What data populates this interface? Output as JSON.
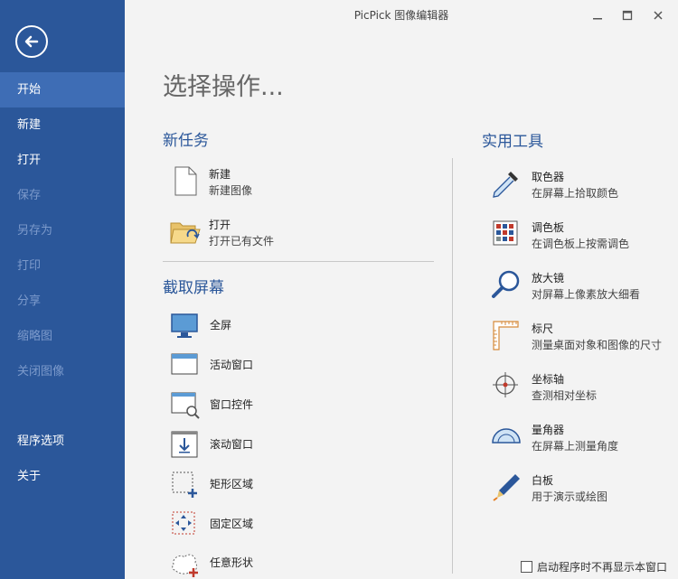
{
  "window": {
    "title": "PicPick 图像编辑器"
  },
  "sidebar": {
    "items": [
      {
        "label": "开始"
      },
      {
        "label": "新建"
      },
      {
        "label": "打开"
      },
      {
        "label": "保存"
      },
      {
        "label": "另存为"
      },
      {
        "label": "打印"
      },
      {
        "label": "分享"
      },
      {
        "label": "缩略图"
      },
      {
        "label": "关闭图像"
      }
    ],
    "bottom_items": [
      {
        "label": "程序选项"
      },
      {
        "label": "关于"
      }
    ]
  },
  "main": {
    "title": "选择操作...",
    "new_task": {
      "heading": "新任务",
      "items": [
        {
          "label": "新建",
          "sub": "新建图像",
          "icon": "new-file-icon"
        },
        {
          "label": "打开",
          "sub": "打开已有文件",
          "icon": "open-folder-icon"
        }
      ]
    },
    "capture": {
      "heading": "截取屏幕",
      "items": [
        {
          "label": "全屏",
          "icon": "monitor-icon"
        },
        {
          "label": "活动窗口",
          "icon": "active-window-icon"
        },
        {
          "label": "窗口控件",
          "icon": "window-control-icon"
        },
        {
          "label": "滚动窗口",
          "icon": "scroll-window-icon"
        },
        {
          "label": "矩形区域",
          "icon": "rectangle-region-icon"
        },
        {
          "label": "固定区域",
          "icon": "fixed-region-icon"
        },
        {
          "label": "任意形状",
          "icon": "freehand-region-icon"
        }
      ]
    },
    "tools": {
      "heading": "实用工具",
      "items": [
        {
          "label": "取色器",
          "sub": "在屏幕上拾取颜色",
          "icon": "eyedropper-icon"
        },
        {
          "label": "调色板",
          "sub": "在调色板上按需调色",
          "icon": "palette-icon"
        },
        {
          "label": "放大镜",
          "sub": "对屏幕上像素放大细看",
          "icon": "magnifier-icon"
        },
        {
          "label": "标尺",
          "sub": "测量桌面对象和图像的尺寸",
          "icon": "ruler-icon"
        },
        {
          "label": "坐标轴",
          "sub": "查测相对坐标",
          "icon": "crosshair-icon"
        },
        {
          "label": "量角器",
          "sub": "在屏幕上测量角度",
          "icon": "protractor-icon"
        },
        {
          "label": "白板",
          "sub": "用于演示或绘图",
          "icon": "whiteboard-pen-icon"
        }
      ]
    },
    "footer": {
      "checkbox_label": "启动程序时不再显示本窗口",
      "checked": false
    }
  },
  "colors": {
    "sidebar": "#2b579a",
    "sidebar_active": "#3e6db5",
    "heading": "#2b579a",
    "background": "#f3f3f3"
  }
}
